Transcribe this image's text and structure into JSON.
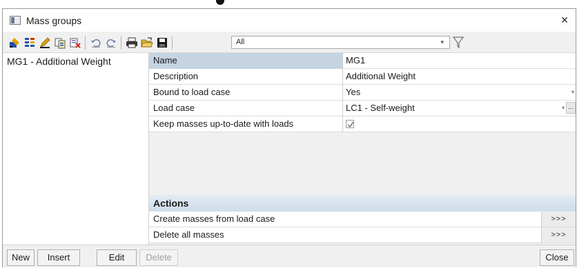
{
  "window": {
    "title": "Mass groups",
    "close_glyph": "×"
  },
  "toolbar": {
    "icons": [
      "new-item-icon",
      "table-icon",
      "edit-pencil-icon",
      "copy-icon",
      "delete-icon",
      "undo-icon",
      "redo-icon",
      "print-icon",
      "open-folder-icon",
      "save-icon"
    ],
    "filter": {
      "value": "All"
    },
    "filter_icon": "funnel-icon"
  },
  "list": {
    "items": [
      {
        "label": "MG1 - Additional Weight"
      }
    ]
  },
  "properties": [
    {
      "name": "Name",
      "value": "MG1"
    },
    {
      "name": "Description",
      "value": "Additional Weight"
    },
    {
      "name": "Bound to load case",
      "value": "Yes"
    },
    {
      "name": "Load case",
      "value": "LC1 - Self-weight"
    },
    {
      "name": "Keep masses up-to-date with loads",
      "value": "",
      "checked": true
    }
  ],
  "actions": {
    "header": "Actions",
    "items": [
      {
        "label": "Create masses from load case",
        "button": ">>>"
      },
      {
        "label": "Delete all masses",
        "button": ">>>"
      }
    ],
    "ellipsis": "..."
  },
  "buttons": {
    "new": "New",
    "insert": "Insert",
    "edit": "Edit",
    "delete": "Delete",
    "close": "Close"
  },
  "colors": {
    "selection": "#c5d3e3",
    "actions_header": "#d6e2ee"
  }
}
